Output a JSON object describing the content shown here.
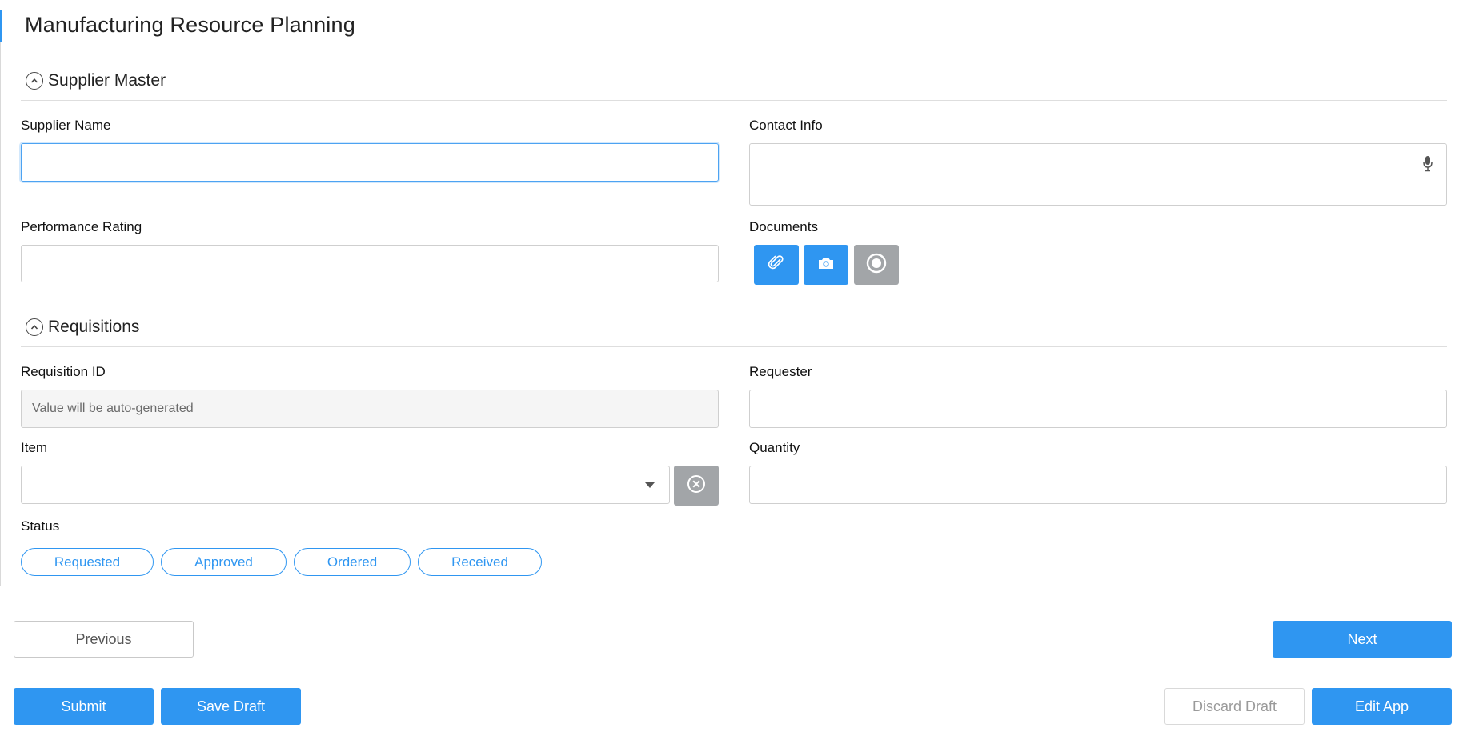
{
  "app": {
    "title": "Manufacturing Resource Planning"
  },
  "colors": {
    "accent": "#2f96f1",
    "gray_button": "#a2a5a8",
    "border": "#cfcfcf"
  },
  "sections": {
    "supplier_master": {
      "title": "Supplier Master",
      "fields": {
        "supplier_name": {
          "label": "Supplier Name",
          "value": ""
        },
        "contact_info": {
          "label": "Contact Info",
          "value": "",
          "icon": "microphone-icon"
        },
        "performance_rating": {
          "label": "Performance Rating",
          "value": ""
        },
        "documents": {
          "label": "Documents",
          "buttons": [
            {
              "icon": "paperclip-icon"
            },
            {
              "icon": "camera-icon"
            },
            {
              "icon": "record-icon"
            }
          ]
        }
      }
    },
    "requisitions": {
      "title": "Requisitions",
      "fields": {
        "requisition_id": {
          "label": "Requisition ID",
          "placeholder": "Value will be auto-generated"
        },
        "requester": {
          "label": "Requester",
          "value": ""
        },
        "item": {
          "label": "Item",
          "value": ""
        },
        "quantity": {
          "label": "Quantity",
          "value": ""
        },
        "status": {
          "label": "Status",
          "options": [
            "Requested",
            "Approved",
            "Ordered",
            "Received"
          ]
        }
      }
    }
  },
  "navigation": {
    "previous": "Previous",
    "next": "Next"
  },
  "footer": {
    "submit": "Submit",
    "save_draft": "Save Draft",
    "discard_draft": "Discard Draft",
    "edit_app": "Edit App"
  }
}
